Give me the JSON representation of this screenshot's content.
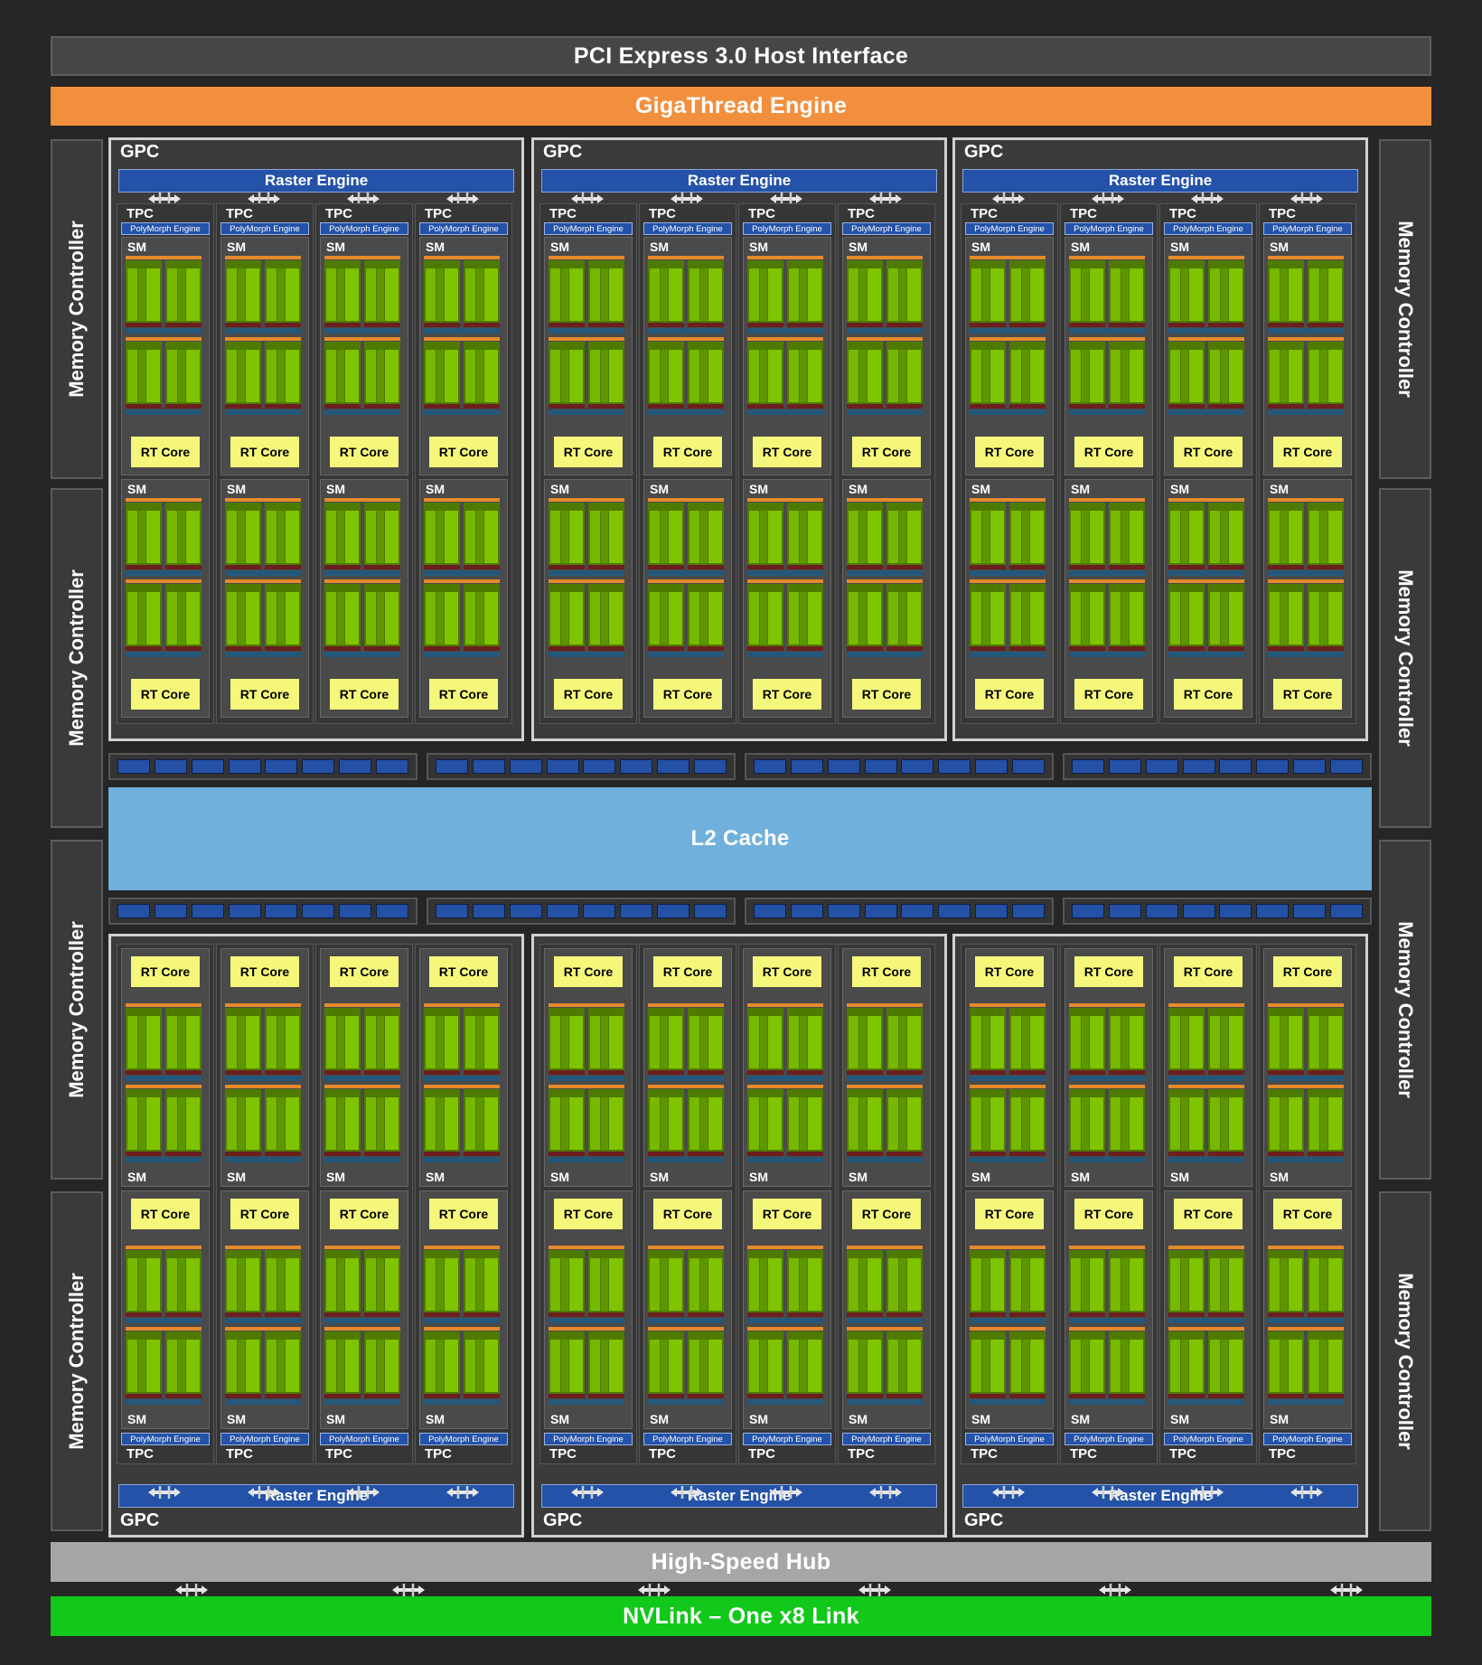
{
  "header": {
    "pcie": "PCI Express 3.0 Host Interface",
    "gigathread": "GigaThread Engine"
  },
  "memory_controller": "Memory Controller",
  "l2_cache": "L2 Cache",
  "footer": {
    "hub": "High-Speed Hub",
    "nvlink": "NVLink – One x8 Link"
  },
  "gpc": {
    "title": "GPC",
    "raster_engine": "Raster Engine",
    "tpc_label": "TPC",
    "polymorph_engine": "PolyMorph Engine",
    "sm_label": "SM",
    "rt_core": "RT Core",
    "gpcs_per_row": 3,
    "tpcs_per_gpc": 4,
    "sms_per_tpc": 2
  },
  "colors": {
    "background": "#262626",
    "gigathread": "#f28f3d",
    "raster_engine": "#2452a8",
    "l2_cache": "#70b0dc",
    "rt_core": "#f4f77a",
    "cuda_core": "#76b900",
    "hub": "#a6a6a6",
    "nvlink": "#12c81a"
  }
}
